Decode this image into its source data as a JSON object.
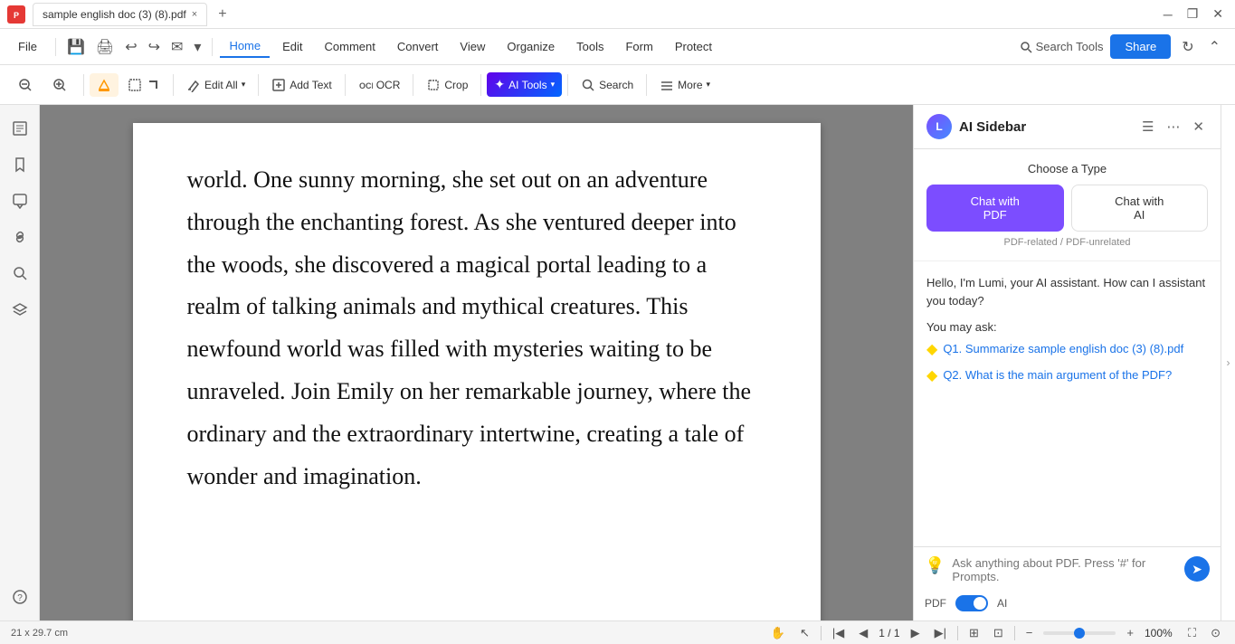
{
  "titleBar": {
    "appIcon": "P",
    "tabTitle": "sample english doc (3) (8).pdf",
    "tabCloseLabel": "×",
    "tabAddLabel": "+"
  },
  "menuBar": {
    "fileLabel": "File",
    "items": [
      {
        "id": "home",
        "label": "Home",
        "active": true
      },
      {
        "id": "edit",
        "label": "Edit",
        "active": false
      },
      {
        "id": "comment",
        "label": "Comment",
        "active": false
      },
      {
        "id": "convert",
        "label": "Convert",
        "active": false
      },
      {
        "id": "view",
        "label": "View",
        "active": false
      },
      {
        "id": "organize",
        "label": "Organize",
        "active": false
      },
      {
        "id": "tools",
        "label": "Tools",
        "active": false
      },
      {
        "id": "form",
        "label": "Form",
        "active": false
      },
      {
        "id": "protect",
        "label": "Protect",
        "active": false
      }
    ],
    "searchToolsLabel": "Search Tools",
    "shareLabel": "Share"
  },
  "toolbar": {
    "zoomOutLabel": "−",
    "zoomInLabel": "+",
    "highlightLabel": "",
    "editAllLabel": "Edit All",
    "addTextLabel": "Add Text",
    "ocrLabel": "OCR",
    "cropLabel": "Crop",
    "aiToolsLabel": "AI Tools",
    "searchLabel": "Search",
    "moreLabel": "More"
  },
  "pdfContent": {
    "text": "world. One sunny morning, she set out on an adventure through the enchanting forest. As she ventured deeper into the woods, she discovered a magical portal leading to a realm of talking animals and mythical creatures. This newfound world was filled with mysteries waiting to be unraveled. Join Emily on her remarkable journey, where the ordinary and the extraordinary intertwine, creating a tale of wonder and imagination."
  },
  "aiSidebar": {
    "title": "AI Sidebar",
    "chooseTypeLabel": "Choose a Type",
    "chatWithPdfLabel": "Chat with\nPDF",
    "chatWithAiLabel": "Chat with\nAI",
    "typeSubLabel": "PDF-related / PDF-unrelated",
    "greetingText": "Hello, I'm Lumi, your AI assistant. How can I assistant you today?",
    "mayAskLabel": "You may ask:",
    "suggestions": [
      {
        "id": "q1",
        "text": "Q1. Summarize sample english doc (3) (8).pdf"
      },
      {
        "id": "q2",
        "text": "Q2. What is the main argument of the PDF?"
      }
    ],
    "inputPlaceholder": "Ask anything about PDF. Press '#' for Prompts.",
    "pdfToggleLabel": "PDF",
    "aiToggleLabel": "AI"
  },
  "statusBar": {
    "dimensions": "21 x 29.7 cm",
    "pageIndicator": "1 / 1",
    "zoomLevel": "100%"
  }
}
